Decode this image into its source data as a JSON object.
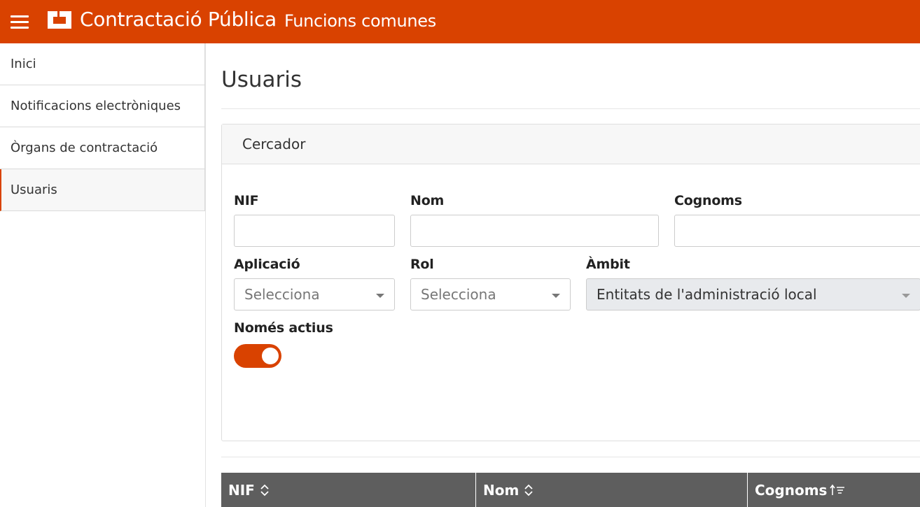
{
  "header": {
    "title": "Contractació Pública",
    "subtitle": "Funcions comunes",
    "background_color": "#d94200"
  },
  "sidebar": {
    "items": [
      {
        "label": "Inici",
        "active": false
      },
      {
        "label": "Notificacions electròniques",
        "active": false
      },
      {
        "label": "Òrgans de contractació",
        "active": false
      },
      {
        "label": "Usuaris",
        "active": true
      }
    ]
  },
  "main": {
    "page_title": "Usuaris",
    "search_card": {
      "title": "Cercador",
      "fields": {
        "nif_label": "NIF",
        "nif_value": "",
        "nom_label": "Nom",
        "nom_value": "",
        "cognoms_label": "Cognoms",
        "cognoms_value": "",
        "aplicacio_label": "Aplicació",
        "aplicacio_value": "Selecciona",
        "rol_label": "Rol",
        "rol_value": "Selecciona",
        "ambit_label": "Àmbit",
        "ambit_value": "Entitats de l'administració local",
        "nomes_actius_label": "Només actius",
        "nomes_actius_on": true
      }
    },
    "table": {
      "columns": [
        {
          "label": "NIF",
          "sort_icon": "sort-both-icon"
        },
        {
          "label": "Nom",
          "sort_icon": "sort-both-icon"
        },
        {
          "label": "Cognoms",
          "sort_icon": "sort-ascending-icon"
        }
      ]
    }
  },
  "colors": {
    "accent": "#d94200",
    "table_header": "#5e5e5e",
    "disabled_select": "#e8eaed"
  }
}
